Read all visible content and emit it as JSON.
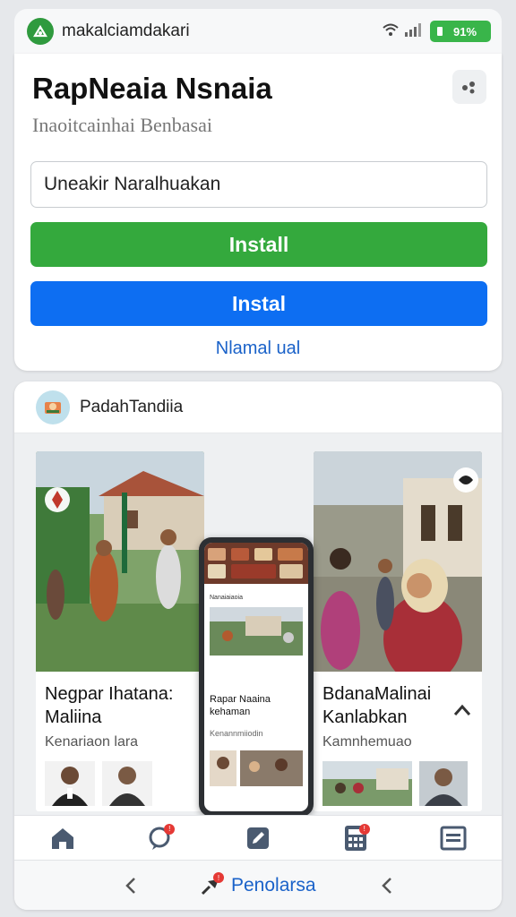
{
  "status": {
    "app_name": "makalciamdakari",
    "battery": "91%"
  },
  "top_card": {
    "title": "RapNeaia Nsnaia",
    "subtitle": "Inaoitcainhai Benbasai",
    "input_value": "Uneakir Naralhuakan",
    "install_primary": "Install",
    "install_secondary": "Instal",
    "link": "Nlamal ual"
  },
  "feed": {
    "author": "PadahTandiia",
    "posts": [
      {
        "title": "Negpar Ihatana: Maliina",
        "subtitle": "Kenariaon lara"
      },
      {
        "title": "BdanaMalinai Kanlabkan",
        "subtitle": "Kamnhemuao"
      }
    ],
    "phone_preview": {
      "app_title": "Nanaiaiaoia",
      "card_title": "Rapar Naaina kehaman",
      "card_sub": "Kenannmiiodin"
    }
  },
  "tabs": [
    {
      "icon": "home-icon",
      "badge": ""
    },
    {
      "icon": "chat-icon",
      "badge": "!"
    },
    {
      "icon": "edit-icon",
      "badge": ""
    },
    {
      "icon": "calculator-icon",
      "badge": "!"
    },
    {
      "icon": "list-icon",
      "badge": ""
    }
  ],
  "bottom_nav": {
    "center_label": "Penolarsa",
    "center_badge": "!"
  },
  "colors": {
    "green": "#34a93d",
    "blue": "#0d6ef2",
    "link": "#1a62c9"
  }
}
